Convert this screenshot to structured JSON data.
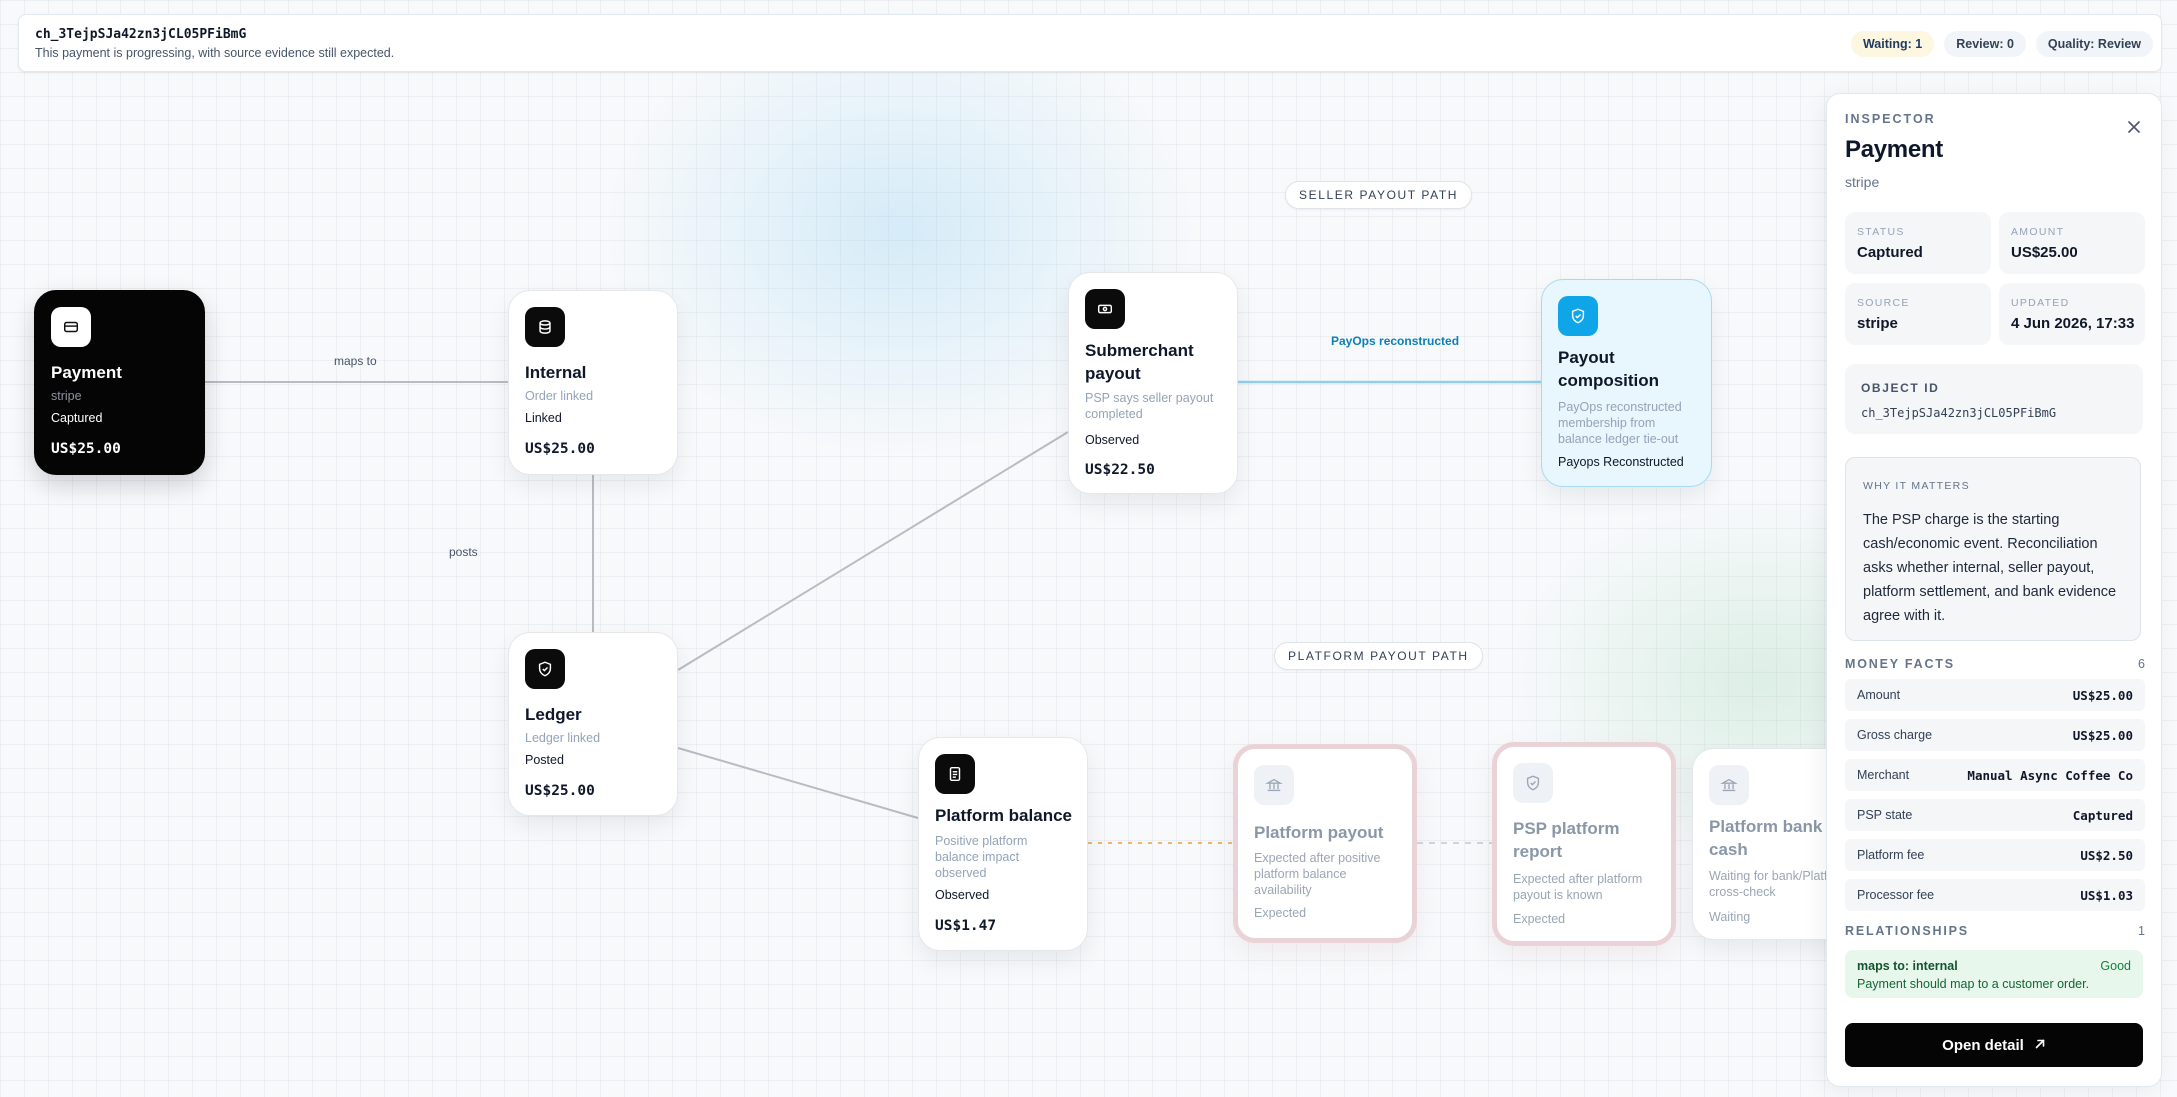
{
  "topbar": {
    "id": "ch_3TejpSJa42zn3jCL05PFiBmG",
    "subtitle": "This payment is progressing, with source evidence still expected.",
    "pills": {
      "waiting": "Waiting: 1",
      "review": "Review: 0",
      "quality": "Quality: Review"
    }
  },
  "canvas": {
    "sections": {
      "seller": "SELLER PAYOUT PATH",
      "platform": "PLATFORM PAYOUT PATH"
    },
    "edge_labels": {
      "maps_to": "maps to",
      "posts": "posts",
      "payops": "PayOps reconstructed"
    },
    "nodes": {
      "payment": {
        "title": "Payment",
        "sub": "stripe",
        "status": "Captured",
        "amount": "US$25.00",
        "icon": "card-icon"
      },
      "internal": {
        "title": "Internal",
        "sub": "Order linked",
        "status": "Linked",
        "amount": "US$25.00",
        "icon": "database-icon"
      },
      "ledger": {
        "title": "Ledger",
        "sub": "Ledger linked",
        "status": "Posted",
        "amount": "US$25.00",
        "icon": "shield-icon"
      },
      "submerchant": {
        "title_1": "Submerchant",
        "title_2": "payout",
        "sub_1": "PSP says seller payout",
        "sub_2": "completed",
        "status": "Observed",
        "amount": "US$22.50",
        "icon": "cash-icon"
      },
      "payout_composition": {
        "title_1": "Payout",
        "title_2": "composition",
        "sub_1": "PayOps reconstructed",
        "sub_2": "membership from",
        "sub_3": "balance ledger tie-out",
        "status": "Payops Reconstructed",
        "icon": "shield-check-icon"
      },
      "platform_balance": {
        "title": "Platform balance",
        "sub_1": "Positive platform",
        "sub_2": "balance impact",
        "sub_3": "observed",
        "status": "Observed",
        "amount": "US$1.47",
        "icon": "document-icon"
      },
      "platform_payout": {
        "title": "Platform payout",
        "sub_1": "Expected after positive",
        "sub_2": "platform balance",
        "sub_3": "availability",
        "status": "Expected",
        "icon": "bank-icon"
      },
      "psp_report": {
        "title_1": "PSP platform",
        "title_2": "report",
        "sub_1": "Expected after platform",
        "sub_2": "payout is known",
        "status": "Expected",
        "icon": "shield-icon"
      },
      "bank_cash": {
        "title_1": "Platform bank",
        "title_2": "cash",
        "sub_1": "Waiting for bank/Platform",
        "sub_2": "cross-check",
        "status": "Waiting",
        "icon": "bank-icon"
      }
    }
  },
  "inspector": {
    "kicker": "INSPECTOR",
    "title": "Payment",
    "subtitle": "stripe",
    "facts": [
      {
        "label": "STATUS",
        "value": "Captured"
      },
      {
        "label": "AMOUNT",
        "value": "US$25.00"
      },
      {
        "label": "SOURCE",
        "value": "stripe"
      },
      {
        "label": "UPDATED",
        "value": "4 Jun 2026, 17:33"
      }
    ],
    "object_id": {
      "label": "OBJECT ID",
      "value": "ch_3TejpSJa42zn3jCL05PFiBmG"
    },
    "why": {
      "label": "WHY IT MATTERS",
      "text": "The PSP charge is the starting cash/economic event. Reconciliation asks whether internal, seller payout, platform settlement, and bank evidence agree with it."
    },
    "money_facts": {
      "label": "MONEY FACTS",
      "count": "6",
      "rows": [
        {
          "label": "Amount",
          "value": "US$25.00"
        },
        {
          "label": "Gross charge",
          "value": "US$25.00"
        },
        {
          "label": "Merchant",
          "value": "Manual Async Coffee Co"
        },
        {
          "label": "PSP state",
          "value": "Captured"
        },
        {
          "label": "Platform fee",
          "value": "US$2.50"
        },
        {
          "label": "Processor fee",
          "value": "US$1.03"
        }
      ]
    },
    "relationships": {
      "label": "RELATIONSHIPS",
      "count": "1",
      "item": {
        "label": "maps to: internal",
        "status": "Good",
        "desc": "Payment should map to a customer order."
      }
    },
    "open_button": "Open detail"
  },
  "colors": {
    "accent_blue": "#0ea5e9",
    "good_bg": "#e7f7ec",
    "expected_ring": "#ead3d6",
    "dashed_orange": "#f2b36b"
  }
}
